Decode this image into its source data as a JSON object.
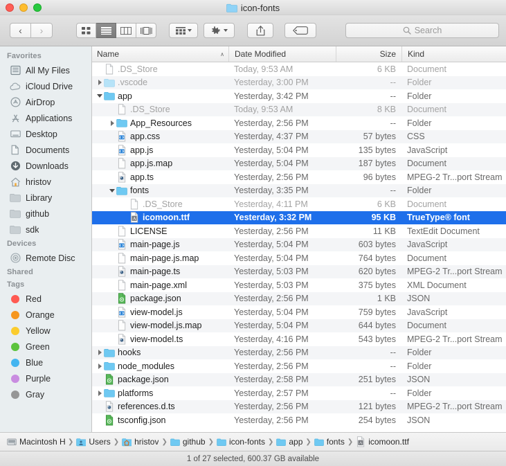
{
  "window": {
    "title": "icon-fonts",
    "traffic_lights": [
      "close-red",
      "minimize-yellow",
      "zoom-green"
    ]
  },
  "toolbar": {
    "back_label": "‹",
    "forward_label": "›",
    "view_modes": [
      "icon-view",
      "list-view",
      "column-view",
      "coverflow-view"
    ],
    "active_view": "list-view",
    "arrange_label": "arrange-icon",
    "action_label": "gear-icon",
    "share_label": "share-icon",
    "tags_label": "tag-icon",
    "search_placeholder": "Search"
  },
  "sidebar": {
    "sections": [
      {
        "header": "Favorites",
        "items": [
          {
            "label": "All My Files",
            "icon": "all-my-files-icon"
          },
          {
            "label": "iCloud Drive",
            "icon": "icloud-icon"
          },
          {
            "label": "AirDrop",
            "icon": "airdrop-icon"
          },
          {
            "label": "Applications",
            "icon": "applications-icon"
          },
          {
            "label": "Desktop",
            "icon": "desktop-icon"
          },
          {
            "label": "Documents",
            "icon": "documents-icon"
          },
          {
            "label": "Downloads",
            "icon": "downloads-icon"
          },
          {
            "label": "hristov",
            "icon": "home-icon"
          },
          {
            "label": "Library",
            "icon": "folder-icon"
          },
          {
            "label": "github",
            "icon": "folder-icon"
          },
          {
            "label": "sdk",
            "icon": "folder-icon"
          }
        ]
      },
      {
        "header": "Devices",
        "items": [
          {
            "label": "Remote Disc",
            "icon": "disc-icon"
          }
        ]
      },
      {
        "header": "Shared",
        "items": []
      },
      {
        "header": "Tags",
        "items": [
          {
            "label": "Red",
            "icon": "tag-dot",
            "color": "#ff5a52"
          },
          {
            "label": "Orange",
            "icon": "tag-dot",
            "color": "#f6961e"
          },
          {
            "label": "Yellow",
            "icon": "tag-dot",
            "color": "#fbcc2d"
          },
          {
            "label": "Green",
            "icon": "tag-dot",
            "color": "#5dc33d"
          },
          {
            "label": "Blue",
            "icon": "tag-dot",
            "color": "#44b5f0"
          },
          {
            "label": "Purple",
            "icon": "tag-dot",
            "color": "#c98ce0"
          },
          {
            "label": "Gray",
            "icon": "tag-dot",
            "color": "#969696"
          }
        ]
      }
    ]
  },
  "columns": {
    "name": "Name",
    "date_modified": "Date Modified",
    "size": "Size",
    "kind": "Kind",
    "sort_indicator": "∧"
  },
  "files": [
    {
      "name": ".DS_Store",
      "date": "Today, 9:53 AM",
      "size": "6 KB",
      "kind": "Document",
      "indent": 0,
      "twisty": "none",
      "icon": "document-icon",
      "dim": true
    },
    {
      "name": ".vscode",
      "date": "Yesterday, 3:00 PM",
      "size": "--",
      "kind": "Folder",
      "indent": 0,
      "twisty": "closed",
      "icon": "folder-light-icon",
      "dim": true
    },
    {
      "name": "app",
      "date": "Yesterday, 3:42 PM",
      "size": "--",
      "kind": "Folder",
      "indent": 0,
      "twisty": "open",
      "icon": "folder-icon",
      "dim": false
    },
    {
      "name": ".DS_Store",
      "date": "Today, 9:53 AM",
      "size": "8 KB",
      "kind": "Document",
      "indent": 1,
      "twisty": "none",
      "icon": "document-icon",
      "dim": true
    },
    {
      "name": "App_Resources",
      "date": "Yesterday, 2:56 PM",
      "size": "--",
      "kind": "Folder",
      "indent": 1,
      "twisty": "closed",
      "icon": "folder-icon",
      "dim": false
    },
    {
      "name": "app.css",
      "date": "Yesterday, 4:37 PM",
      "size": "57 bytes",
      "kind": "CSS",
      "indent": 1,
      "twisty": "none",
      "icon": "code-doc-icon",
      "dim": false
    },
    {
      "name": "app.js",
      "date": "Yesterday, 5:04 PM",
      "size": "135 bytes",
      "kind": "JavaScript",
      "indent": 1,
      "twisty": "none",
      "icon": "code-doc-icon",
      "dim": false
    },
    {
      "name": "app.js.map",
      "date": "Yesterday, 5:04 PM",
      "size": "187 bytes",
      "kind": "Document",
      "indent": 1,
      "twisty": "none",
      "icon": "document-icon",
      "dim": false
    },
    {
      "name": "app.ts",
      "date": "Yesterday, 2:56 PM",
      "size": "96 bytes",
      "kind": "MPEG-2 Tr...port Stream",
      "indent": 1,
      "twisty": "none",
      "icon": "ts-doc-icon",
      "dim": false
    },
    {
      "name": "fonts",
      "date": "Yesterday, 3:35 PM",
      "size": "--",
      "kind": "Folder",
      "indent": 1,
      "twisty": "open",
      "icon": "folder-icon",
      "dim": false
    },
    {
      "name": ".DS_Store",
      "date": "Yesterday, 4:11 PM",
      "size": "6 KB",
      "kind": "Document",
      "indent": 2,
      "twisty": "none",
      "icon": "document-icon",
      "dim": true
    },
    {
      "name": "icomoon.ttf",
      "date": "Yesterday, 3:32 PM",
      "size": "95 KB",
      "kind": "TrueType® font",
      "indent": 2,
      "twisty": "none",
      "icon": "font-doc-icon",
      "dim": false,
      "selected": true
    },
    {
      "name": "LICENSE",
      "date": "Yesterday, 2:56 PM",
      "size": "11 KB",
      "kind": "TextEdit Document",
      "indent": 1,
      "twisty": "none",
      "icon": "document-icon",
      "dim": false
    },
    {
      "name": "main-page.js",
      "date": "Yesterday, 5:04 PM",
      "size": "603 bytes",
      "kind": "JavaScript",
      "indent": 1,
      "twisty": "none",
      "icon": "code-doc-icon",
      "dim": false
    },
    {
      "name": "main-page.js.map",
      "date": "Yesterday, 5:04 PM",
      "size": "764 bytes",
      "kind": "Document",
      "indent": 1,
      "twisty": "none",
      "icon": "document-icon",
      "dim": false
    },
    {
      "name": "main-page.ts",
      "date": "Yesterday, 5:03 PM",
      "size": "620 bytes",
      "kind": "MPEG-2 Tr...port Stream",
      "indent": 1,
      "twisty": "none",
      "icon": "ts-doc-icon",
      "dim": false
    },
    {
      "name": "main-page.xml",
      "date": "Yesterday, 5:03 PM",
      "size": "375 bytes",
      "kind": "XML Document",
      "indent": 1,
      "twisty": "none",
      "icon": "document-icon",
      "dim": false
    },
    {
      "name": "package.json",
      "date": "Yesterday, 2:56 PM",
      "size": "1 KB",
      "kind": "JSON",
      "indent": 1,
      "twisty": "none",
      "icon": "json-doc-icon",
      "dim": false
    },
    {
      "name": "view-model.js",
      "date": "Yesterday, 5:04 PM",
      "size": "759 bytes",
      "kind": "JavaScript",
      "indent": 1,
      "twisty": "none",
      "icon": "code-doc-icon",
      "dim": false
    },
    {
      "name": "view-model.js.map",
      "date": "Yesterday, 5:04 PM",
      "size": "644 bytes",
      "kind": "Document",
      "indent": 1,
      "twisty": "none",
      "icon": "document-icon",
      "dim": false
    },
    {
      "name": "view-model.ts",
      "date": "Yesterday, 4:16 PM",
      "size": "543 bytes",
      "kind": "MPEG-2 Tr...port Stream",
      "indent": 1,
      "twisty": "none",
      "icon": "ts-doc-icon",
      "dim": false
    },
    {
      "name": "hooks",
      "date": "Yesterday, 2:56 PM",
      "size": "--",
      "kind": "Folder",
      "indent": 0,
      "twisty": "closed",
      "icon": "folder-icon",
      "dim": false
    },
    {
      "name": "node_modules",
      "date": "Yesterday, 2:56 PM",
      "size": "--",
      "kind": "Folder",
      "indent": 0,
      "twisty": "closed",
      "icon": "folder-icon",
      "dim": false
    },
    {
      "name": "package.json",
      "date": "Yesterday, 2:58 PM",
      "size": "251 bytes",
      "kind": "JSON",
      "indent": 0,
      "twisty": "none",
      "icon": "json-doc-icon",
      "dim": false
    },
    {
      "name": "platforms",
      "date": "Yesterday, 2:57 PM",
      "size": "--",
      "kind": "Folder",
      "indent": 0,
      "twisty": "closed",
      "icon": "folder-icon",
      "dim": false
    },
    {
      "name": "references.d.ts",
      "date": "Yesterday, 2:56 PM",
      "size": "121 bytes",
      "kind": "MPEG-2 Tr...port Stream",
      "indent": 0,
      "twisty": "none",
      "icon": "ts-doc-icon",
      "dim": false
    },
    {
      "name": "tsconfig.json",
      "date": "Yesterday, 2:56 PM",
      "size": "254 bytes",
      "kind": "JSON",
      "indent": 0,
      "twisty": "none",
      "icon": "json-doc-icon",
      "dim": false
    }
  ],
  "pathbar": [
    {
      "label": "Macintosh HD",
      "icon": "harddisk-icon"
    },
    {
      "label": "Users",
      "icon": "users-folder-icon"
    },
    {
      "label": "hristov",
      "icon": "home-folder-icon"
    },
    {
      "label": "github",
      "icon": "folder-icon"
    },
    {
      "label": "icon-fonts",
      "icon": "folder-icon"
    },
    {
      "label": "app",
      "icon": "folder-icon"
    },
    {
      "label": "fonts",
      "icon": "folder-icon"
    },
    {
      "label": "icomoon.ttf",
      "icon": "font-doc-icon"
    }
  ],
  "status": "1 of 27 selected, 600.37 GB available",
  "colors": {
    "selection_blue": "#1e6fea",
    "sidebar_bg": "#e9eef0",
    "folder_blue": "#6fc9f2"
  }
}
